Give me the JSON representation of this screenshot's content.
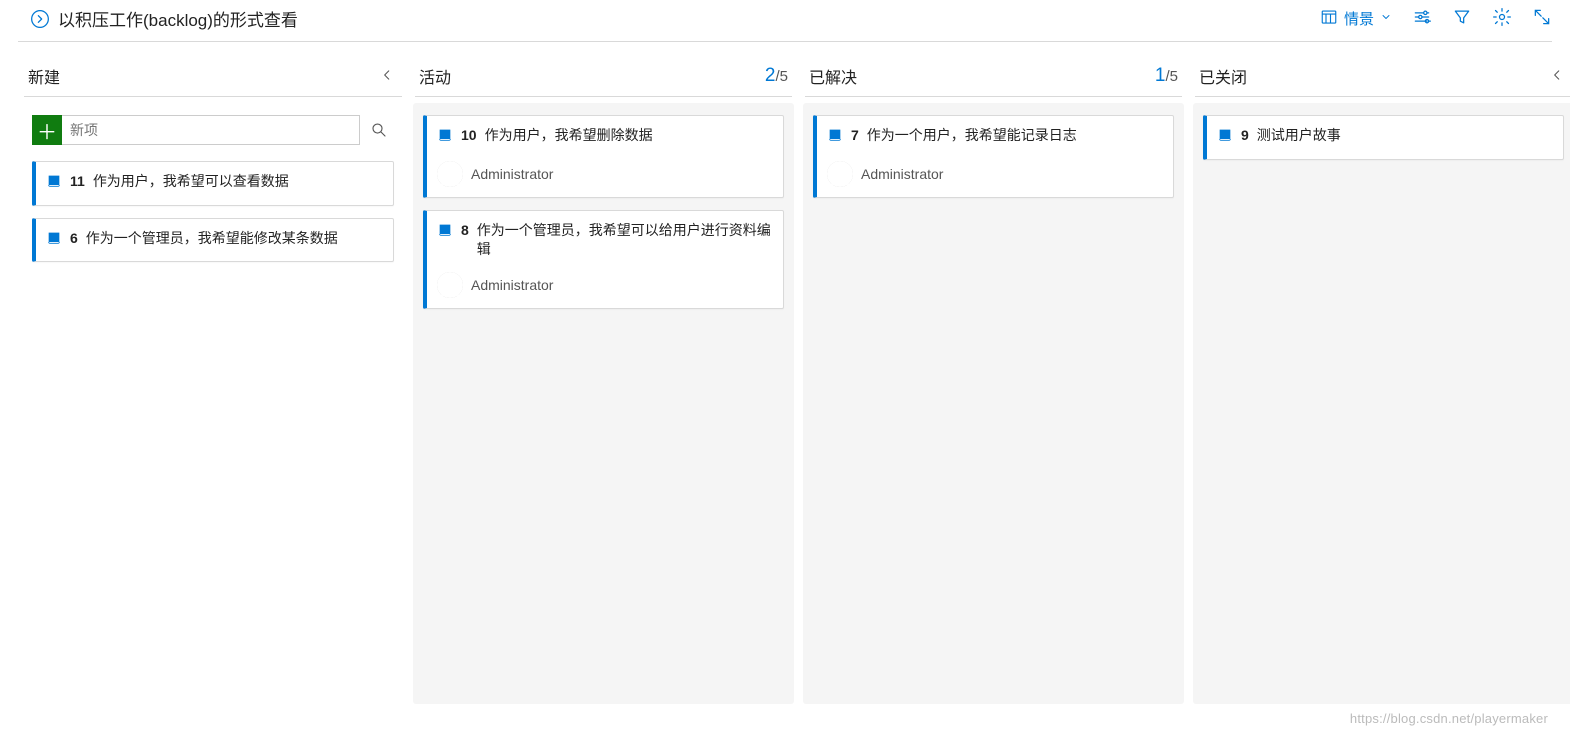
{
  "header": {
    "title": "以积压工作(backlog)的形式查看",
    "scenario_label": "情景"
  },
  "newItem": {
    "placeholder": "新项"
  },
  "columns": {
    "new": {
      "title": "新建",
      "collapsible": true
    },
    "active": {
      "title": "活动",
      "count_current": "2",
      "count_limit": "/5"
    },
    "resolved": {
      "title": "已解决",
      "count_current": "1",
      "count_limit": "/5"
    },
    "closed": {
      "title": "已关闭",
      "collapsible": true
    }
  },
  "cards": {
    "c11": {
      "id": "11",
      "title": "作为用户，我希望可以查看数据"
    },
    "c6": {
      "id": "6",
      "title": "作为一个管理员，我希望能修改某条数据"
    },
    "c10": {
      "id": "10",
      "title": "作为用户，我希望删除数据",
      "assignee": "Administrator"
    },
    "c8": {
      "id": "8",
      "title": "作为一个管理员，我希望可以给用户进行资料编辑",
      "assignee": "Administrator"
    },
    "c7": {
      "id": "7",
      "title": "作为一个用户，我希望能记录日志",
      "assignee": "Administrator"
    },
    "c9": {
      "id": "9",
      "title": "测试用户故事"
    }
  },
  "watermark": "https://blog.csdn.net/playermaker"
}
